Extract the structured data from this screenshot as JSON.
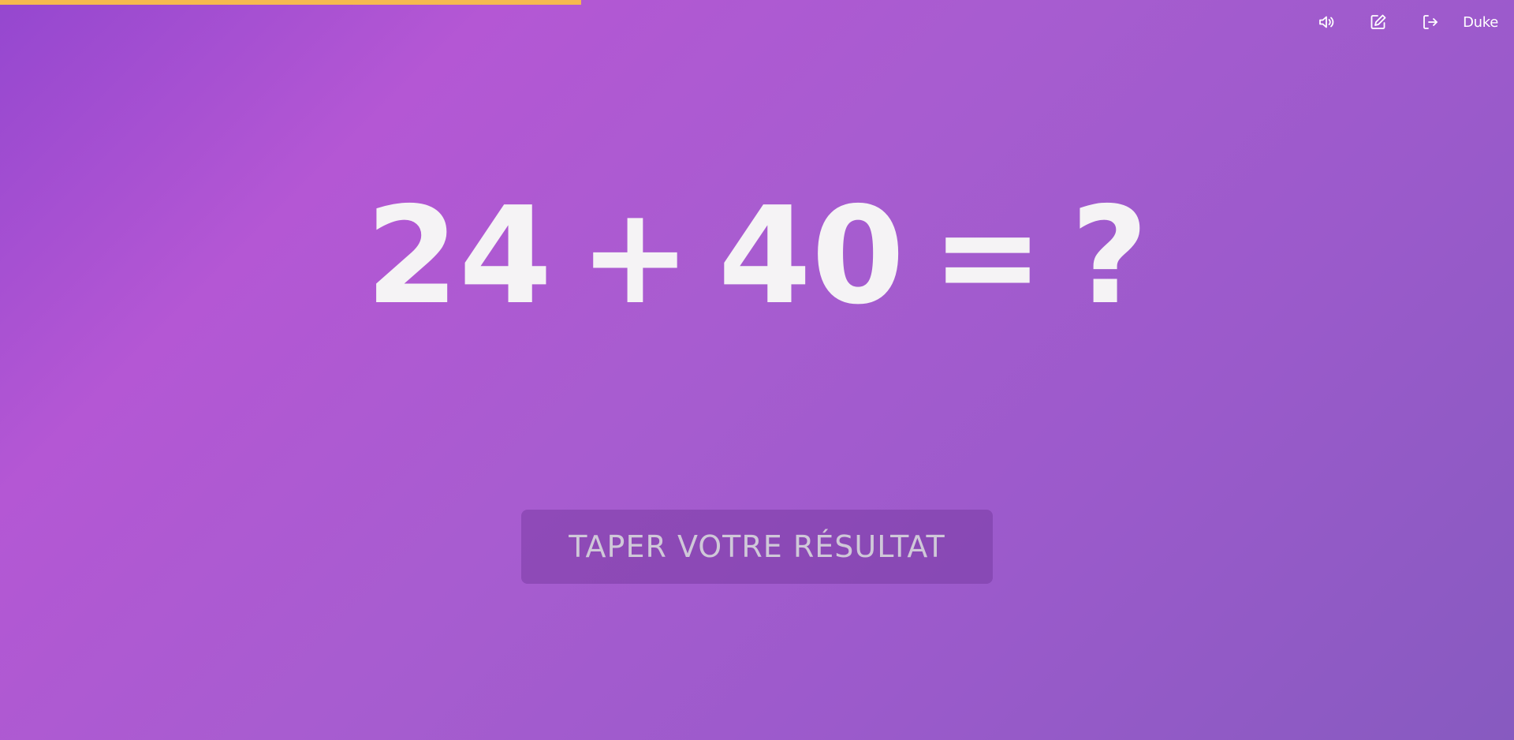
{
  "progress": {
    "fraction": 0.384,
    "color": "#f6b94e"
  },
  "topbar": {
    "icons": [
      "speaker-icon",
      "edit-icon",
      "logout-icon"
    ],
    "user_name": "Duke"
  },
  "equation": {
    "operand_a": "24",
    "operator": "+",
    "operand_b": "40",
    "equals": "=",
    "unknown": "?"
  },
  "answer_button": {
    "label": "TAPER VOTRE RÉSULTAT"
  },
  "colors": {
    "background_start": "#9547cf",
    "background_end": "#875ac0",
    "text": "#f5f3f5"
  }
}
